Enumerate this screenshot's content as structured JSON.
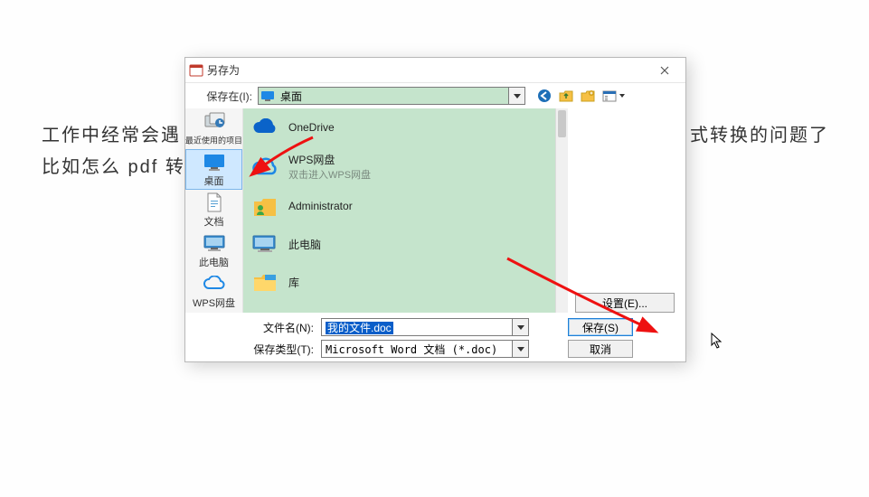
{
  "background": {
    "line1_left": "工作中经常会遇",
    "line1_right": "式转换的问题了",
    "line2": "比如怎么 pdf 转"
  },
  "dialog": {
    "title": "另存为",
    "save_in_label": "保存在(I):",
    "location": "桌面"
  },
  "sidebar": {
    "items": [
      {
        "label": "最近使用的项目"
      },
      {
        "label": "桌面"
      },
      {
        "label": "文档"
      },
      {
        "label": "此电脑"
      },
      {
        "label": "WPS网盘"
      }
    ]
  },
  "filepane": {
    "items": [
      {
        "label": "OneDrive",
        "sub": ""
      },
      {
        "label": "WPS网盘",
        "sub": "双击进入WPS网盘"
      },
      {
        "label": "Administrator",
        "sub": ""
      },
      {
        "label": "此电脑",
        "sub": ""
      },
      {
        "label": "库",
        "sub": ""
      }
    ]
  },
  "settings_btn": "设置(E)...",
  "form": {
    "filename_label": "文件名(N):",
    "filename_value": "我的文件.doc",
    "type_label": "保存类型(T):",
    "type_value": "Microsoft Word 文档 (*.doc)"
  },
  "buttons": {
    "save": "保存(S)",
    "cancel": "取消"
  }
}
